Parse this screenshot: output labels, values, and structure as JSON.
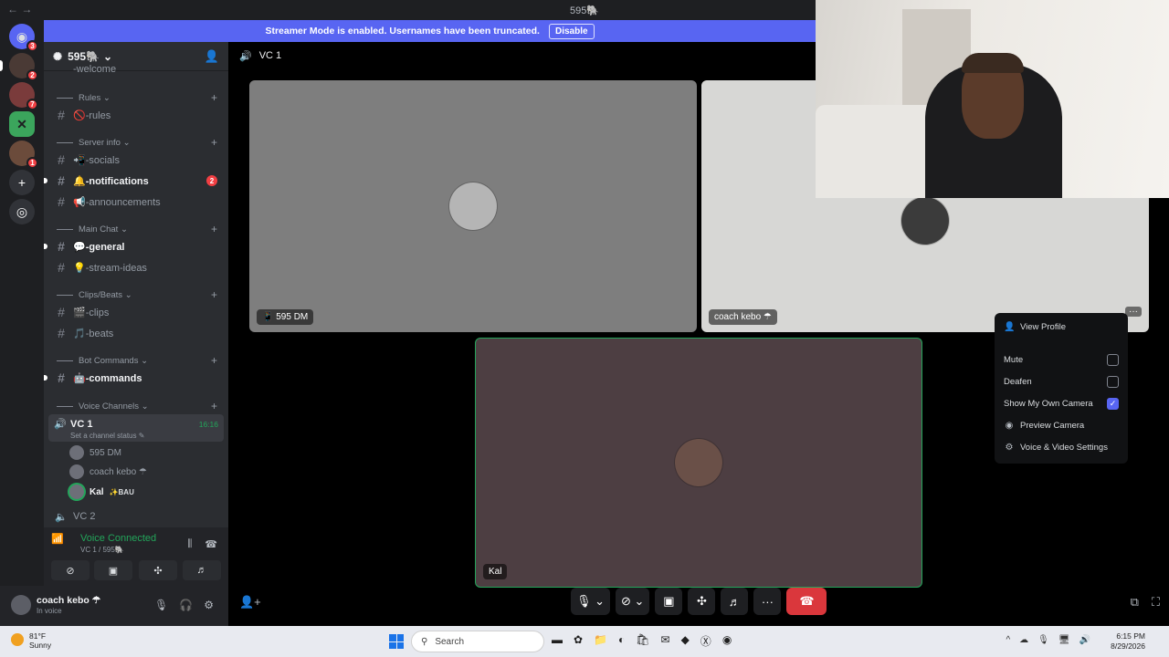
{
  "titlebar": {
    "back": "←  →",
    "title": "595🐘"
  },
  "banner": {
    "text": "Streamer Mode is enabled. Usernames have been truncated.",
    "button": "Disable"
  },
  "rail": {
    "badges": [
      "3",
      "2",
      "7",
      "1"
    ]
  },
  "server": {
    "name": "595🐘"
  },
  "sidebar": {
    "cut_item": "-welcome",
    "categories": {
      "rules": "Rules",
      "server_info": "Server info",
      "main_chat": "Main Chat",
      "clips_beats": "Clips/Beats",
      "bot_commands": "Bot Commands",
      "voice_channels": "Voice Channels"
    },
    "channels": {
      "rules": "🚫-rules",
      "socials": "📲-socials",
      "notifications": "🔔-notifications",
      "notifications_badge": "2",
      "announcements": "📢-announcements",
      "general": "💬-general",
      "stream_ideas": "💡-stream-ideas",
      "clips": "🎬-clips",
      "beats": "🎵-beats",
      "commands": "🤖-commands"
    },
    "vc1": {
      "name": "VC 1",
      "status": "Set a channel status ✎",
      "timer": "16:16"
    },
    "voice_users": [
      {
        "name": "595 DM",
        "tag": ""
      },
      {
        "name": "coach kebo ☂",
        "tag": ""
      },
      {
        "name": "Kal",
        "tag": "✨BAU"
      }
    ],
    "vc2": "VC 2"
  },
  "voice_panel": {
    "title": "Voice Connected",
    "sub": "VC 1 / 595🐘"
  },
  "user_panel": {
    "name": "coach kebo ☂",
    "status": "In voice"
  },
  "main": {
    "header": "VC 1",
    "tiles": [
      {
        "label": "📱 595 DM"
      },
      {
        "label": "coach kebo ☂"
      },
      {
        "label": "Kal"
      }
    ]
  },
  "context_menu": {
    "view_profile": "View Profile",
    "mute": "Mute",
    "deafen": "Deafen",
    "show_own_camera": "Show My Own Camera",
    "preview_camera": "Preview Camera",
    "voice_video_settings": "Voice & Video Settings"
  },
  "taskbar": {
    "temp": "81°F",
    "weather": "Sunny",
    "search": "Search",
    "time": "6:15 PM",
    "date": "8/29/2026"
  },
  "colors": {
    "accent": "#5865f2",
    "green": "#23a55a",
    "red": "#da373c"
  }
}
